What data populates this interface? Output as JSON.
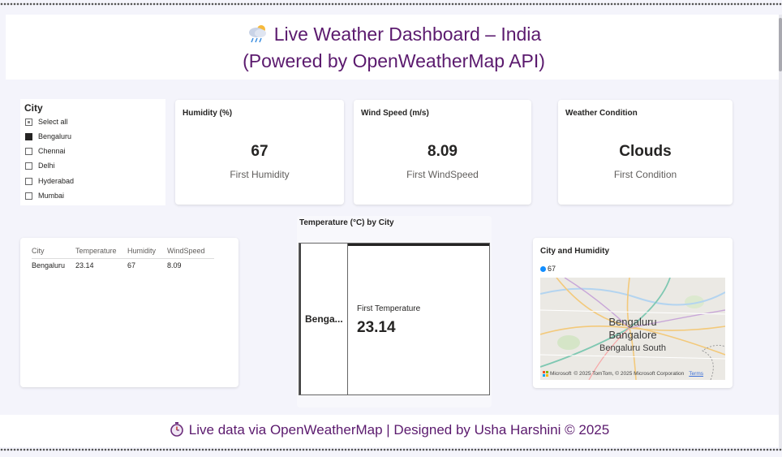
{
  "header": {
    "title_line1": "Live Weather Dashboard – India",
    "title_line2": "(Powered by OpenWeatherMap API)",
    "icon": "cloud-rain-sun-icon"
  },
  "slicer": {
    "title": "City",
    "items": [
      {
        "label": "Select all",
        "state": "partial"
      },
      {
        "label": "Bengaluru",
        "state": "checked"
      },
      {
        "label": "Chennai",
        "state": "unchecked"
      },
      {
        "label": "Delhi",
        "state": "unchecked"
      },
      {
        "label": "Hyderabad",
        "state": "unchecked"
      },
      {
        "label": "Mumbai",
        "state": "unchecked"
      }
    ]
  },
  "kpis": {
    "humidity": {
      "title": "Humidity (%)",
      "value": "67",
      "label": "First Humidity"
    },
    "wind": {
      "title": "Wind Speed (m/s)",
      "value": "8.09",
      "label": "First WindSpeed"
    },
    "condition": {
      "title": "Weather Condition",
      "value": "Clouds",
      "label": "First Condition"
    }
  },
  "table": {
    "headers": [
      "City",
      "Temperature",
      "Humidity",
      "WindSpeed"
    ],
    "rows": [
      [
        "Bengaluru",
        "23.14",
        "67",
        "8.09"
      ]
    ]
  },
  "temperature": {
    "title": "Temperature (°C) by City",
    "category": "Benga...",
    "label": "First Temperature",
    "value": "23.14"
  },
  "map": {
    "title": "City and Humidity",
    "legend_value": "67",
    "city_line1": "Bengaluru",
    "city_line2": "Bangalore",
    "city_line3": "Bengaluru South",
    "attribution": "© 2025 TomTom, © 2025 Microsoft Corporation",
    "attribution_brand": "Microsoft",
    "terms": "Terms",
    "dot_color": "#118dff"
  },
  "footer": {
    "text": "Live data via OpenWeatherMap | Designed by Usha Harshini © 2025",
    "icon": "stopwatch-icon"
  },
  "colors": {
    "title_purple": "#5b1a6e",
    "background": "#f4f4fb"
  }
}
